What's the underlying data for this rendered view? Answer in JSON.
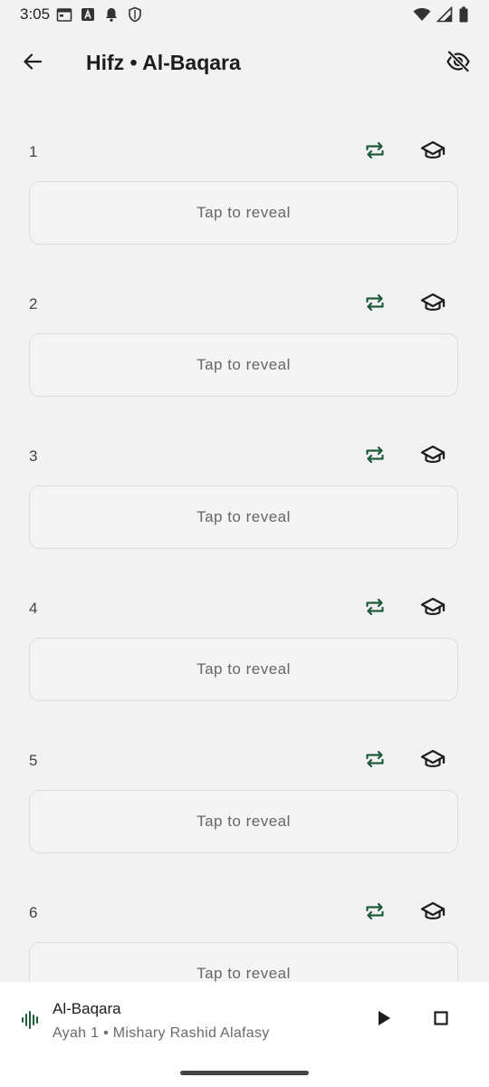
{
  "status_bar": {
    "time": "3:05",
    "left_icons": [
      "calendar-icon",
      "font-a-icon",
      "bell-icon",
      "shield-icon"
    ],
    "right_icons": [
      "wifi-icon",
      "cell-signal-icon",
      "battery-icon"
    ]
  },
  "app_bar": {
    "title": "Hifz • Al-Baqara",
    "back_icon": "arrow-back-icon",
    "visibility_icon": "visibility-off-icon"
  },
  "colors": {
    "accent": "#1e5c3a",
    "background": "#f2f2f2",
    "card_border": "#dcdcdc",
    "text_primary": "#1d1d1d",
    "text_secondary": "#666666"
  },
  "ayahs": [
    {
      "number": "1",
      "reveal_label": "Tap to reveal"
    },
    {
      "number": "2",
      "reveal_label": "Tap to reveal"
    },
    {
      "number": "3",
      "reveal_label": "Tap to reveal"
    },
    {
      "number": "4",
      "reveal_label": "Tap to reveal"
    },
    {
      "number": "5",
      "reveal_label": "Tap to reveal"
    },
    {
      "number": "6",
      "reveal_label": "Tap to reveal"
    }
  ],
  "player": {
    "title": "Al-Baqara",
    "subtitle": "Ayah 1 • Mishary Rashid Alafasy",
    "icons": [
      "audio-wave-icon",
      "play-icon",
      "stop-icon"
    ]
  }
}
